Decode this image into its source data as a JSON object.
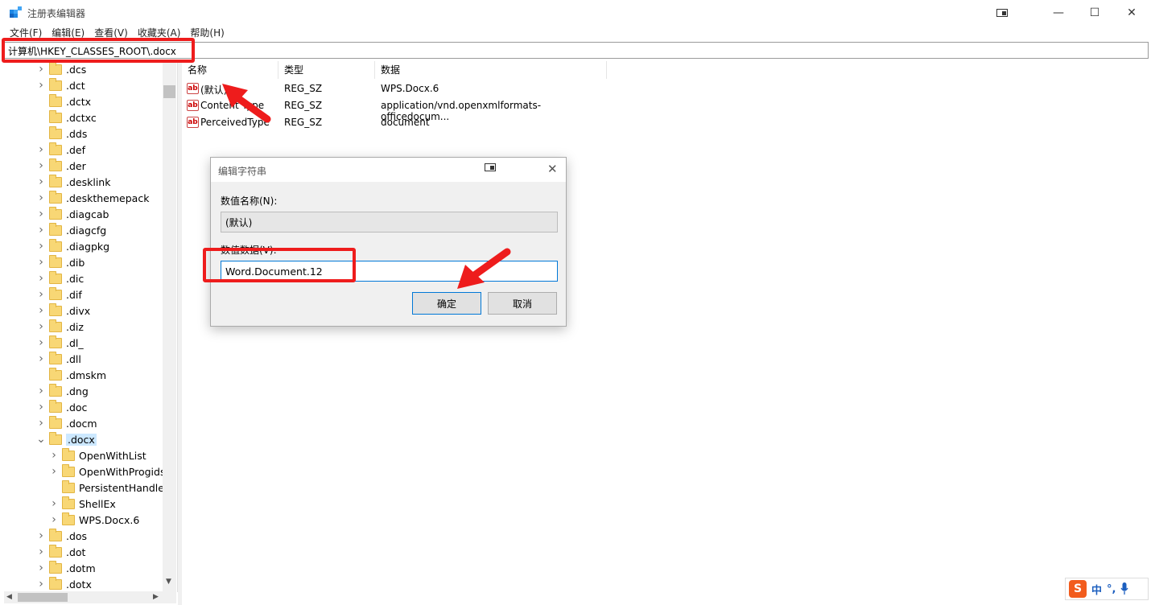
{
  "window": {
    "title": "注册表编辑器",
    "controls": {
      "minimize": "—",
      "maximize": "☐",
      "close": "✕"
    }
  },
  "menu": [
    "文件(F)",
    "编辑(E)",
    "查看(V)",
    "收藏夹(A)",
    "帮助(H)"
  ],
  "address": "计算机\\HKEY_CLASSES_ROOT\\.docx",
  "tree": {
    "items": [
      {
        "label": ".dcs",
        "expandable": true
      },
      {
        "label": ".dct",
        "expandable": true
      },
      {
        "label": ".dctx",
        "expandable": false
      },
      {
        "label": ".dctxc",
        "expandable": false
      },
      {
        "label": ".dds",
        "expandable": false
      },
      {
        "label": ".def",
        "expandable": true
      },
      {
        "label": ".der",
        "expandable": true
      },
      {
        "label": ".desklink",
        "expandable": true
      },
      {
        "label": ".deskthemepack",
        "expandable": true
      },
      {
        "label": ".diagcab",
        "expandable": true
      },
      {
        "label": ".diagcfg",
        "expandable": true
      },
      {
        "label": ".diagpkg",
        "expandable": true
      },
      {
        "label": ".dib",
        "expandable": true
      },
      {
        "label": ".dic",
        "expandable": true
      },
      {
        "label": ".dif",
        "expandable": true
      },
      {
        "label": ".divx",
        "expandable": true
      },
      {
        "label": ".diz",
        "expandable": true
      },
      {
        "label": ".dl_",
        "expandable": true
      },
      {
        "label": ".dll",
        "expandable": true
      },
      {
        "label": ".dmskm",
        "expandable": false
      },
      {
        "label": ".dng",
        "expandable": true
      },
      {
        "label": ".doc",
        "expandable": true
      },
      {
        "label": ".docm",
        "expandable": true
      },
      {
        "label": ".docx",
        "expandable": true,
        "expanded": true,
        "selected": true
      },
      {
        "label": "OpenWithList",
        "expandable": true,
        "child": true
      },
      {
        "label": "OpenWithProgids",
        "expandable": true,
        "child": true
      },
      {
        "label": "PersistentHandler",
        "expandable": false,
        "child": true
      },
      {
        "label": "ShellEx",
        "expandable": true,
        "child": true
      },
      {
        "label": "WPS.Docx.6",
        "expandable": true,
        "child": true
      },
      {
        "label": ".dos",
        "expandable": true
      },
      {
        "label": ".dot",
        "expandable": true
      },
      {
        "label": ".dotm",
        "expandable": true
      },
      {
        "label": ".dotx",
        "expandable": true
      }
    ]
  },
  "list": {
    "columns": [
      "名称",
      "类型",
      "数据"
    ],
    "rows": [
      {
        "name": "(默认)",
        "type": "REG_SZ",
        "data": "WPS.Docx.6",
        "icon": "ab"
      },
      {
        "name": "Content Type",
        "type": "REG_SZ",
        "data": "application/vnd.openxmlformats-officedocum...",
        "icon": "ab"
      },
      {
        "name": "PerceivedType",
        "type": "REG_SZ",
        "data": "document",
        "icon": "ab"
      }
    ]
  },
  "dialog": {
    "title": "编辑字符串",
    "name_label": "数值名称(N):",
    "name_value": "(默认)",
    "data_label": "数值数据(V):",
    "data_value": "Word.Document.12",
    "ok_label": "确定",
    "cancel_label": "取消"
  },
  "ime": {
    "logo": "S",
    "mode": "中",
    "punct": "°,"
  },
  "colors": {
    "annotation": "#ee1c1c",
    "selection": "#cce8ff",
    "focus": "#0078d7",
    "folder": "#f8d775"
  }
}
